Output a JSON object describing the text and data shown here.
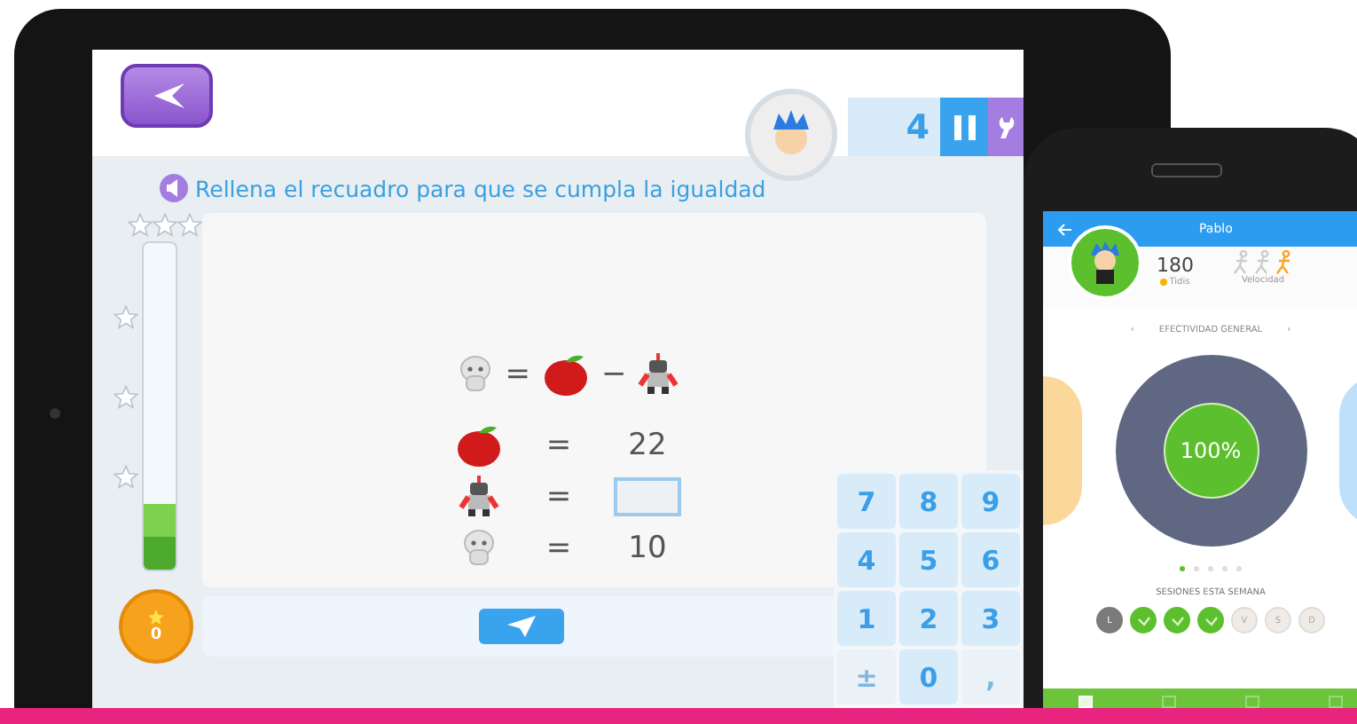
{
  "tablet": {
    "score": "4",
    "instruction": "Rellena el recuadro para que se cumpla la igualdad",
    "progress": {
      "level": 0.2
    },
    "stars_earned": "0",
    "equation": {
      "operators": [
        "=",
        "−"
      ]
    },
    "rows": [
      {
        "kind": "value",
        "sign": "=",
        "value": "22"
      },
      {
        "kind": "input",
        "sign": "="
      },
      {
        "kind": "value",
        "sign": "=",
        "value": "10"
      }
    ],
    "keypad": [
      {
        "label": "7",
        "disabled": false
      },
      {
        "label": "8",
        "disabled": false
      },
      {
        "label": "9",
        "disabled": false
      },
      {
        "label": "4",
        "disabled": false
      },
      {
        "label": "5",
        "disabled": false
      },
      {
        "label": "6",
        "disabled": false
      },
      {
        "label": "1",
        "disabled": false
      },
      {
        "label": "2",
        "disabled": false
      },
      {
        "label": "3",
        "disabled": false
      },
      {
        "label": "±",
        "disabled": true
      },
      {
        "label": "0",
        "disabled": false
      },
      {
        "label": ",",
        "disabled": true
      }
    ]
  },
  "phone": {
    "title": "Pablo",
    "points": "180",
    "points_label": "Tidis",
    "speed_label": "Velocidad",
    "speed_levels": [
      {
        "selected": false
      },
      {
        "selected": false
      },
      {
        "selected": true
      }
    ],
    "section_prev": "‹",
    "section_title": "EFECTIVIDAD GENERAL",
    "section_next": "›",
    "effectiveness": "100%",
    "pages": [
      {
        "selected": true
      },
      {
        "selected": false
      },
      {
        "selected": false
      },
      {
        "selected": false
      },
      {
        "selected": false
      }
    ],
    "sessions_title": "SESIONES ESTA SEMANA",
    "days": [
      {
        "kind": "missed",
        "label": "L"
      },
      {
        "kind": "done"
      },
      {
        "kind": "done"
      },
      {
        "kind": "done"
      },
      {
        "kind": "upcoming",
        "label": "V"
      },
      {
        "kind": "upcoming",
        "label": "S"
      },
      {
        "kind": "upcoming",
        "label": "D"
      }
    ],
    "tabs": [
      {
        "selected": true
      },
      {
        "selected": false
      },
      {
        "selected": false
      },
      {
        "selected": false
      }
    ]
  }
}
